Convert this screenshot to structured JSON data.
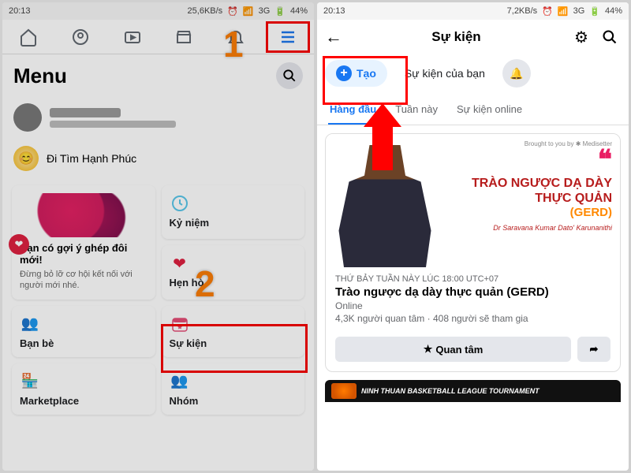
{
  "status": {
    "time": "20:13",
    "speed1": "25,6KB/s",
    "speed2": "7,2KB/s",
    "net": "3G",
    "batt": "44%"
  },
  "left": {
    "title": "Menu",
    "profile_name": "",
    "profile_meta": "",
    "suggest": "Đi Tìm Hạnh Phúc",
    "dating": {
      "title": "Bạn có gợi ý ghép đôi mới!",
      "desc": "Đừng bỏ lỡ cơ hội kết nối với người mới nhé."
    },
    "cards": {
      "memories": "Kỷ niệm",
      "dating": "Hẹn hò",
      "events": "Sự kiện",
      "friends": "Bạn bè",
      "groups": "Nhóm",
      "marketplace": "Marketplace"
    }
  },
  "right": {
    "title": "Sự kiện",
    "create": "Tạo",
    "yours": "Sự kiện của bạn",
    "tabs": {
      "top": "Hàng đầu",
      "week": "Tuần này",
      "online": "Sự kiện online"
    },
    "event": {
      "brand": "Brought to you by ✱ Medisetter",
      "headline": "TRÀO NGƯỢC DẠ DÀY THỰC QUẢN",
      "sub": "(GERD)",
      "doctor": "Dr Saravana Kumar Dato' Karunanithi",
      "time": "THỨ BẢY TUẦN NÀY LÚC 18:00 UTC+07",
      "name": "Trào ngược dạ dày thực quản (GERD)",
      "loc": "Online",
      "stats": "4,3K người quan tâm · 408 người sẽ tham gia",
      "interested": "Quan tâm"
    },
    "bball": "NINH THUAN BASKETBALL LEAGUE TOURNAMENT"
  },
  "annot": {
    "n1": "1",
    "n2": "2"
  }
}
